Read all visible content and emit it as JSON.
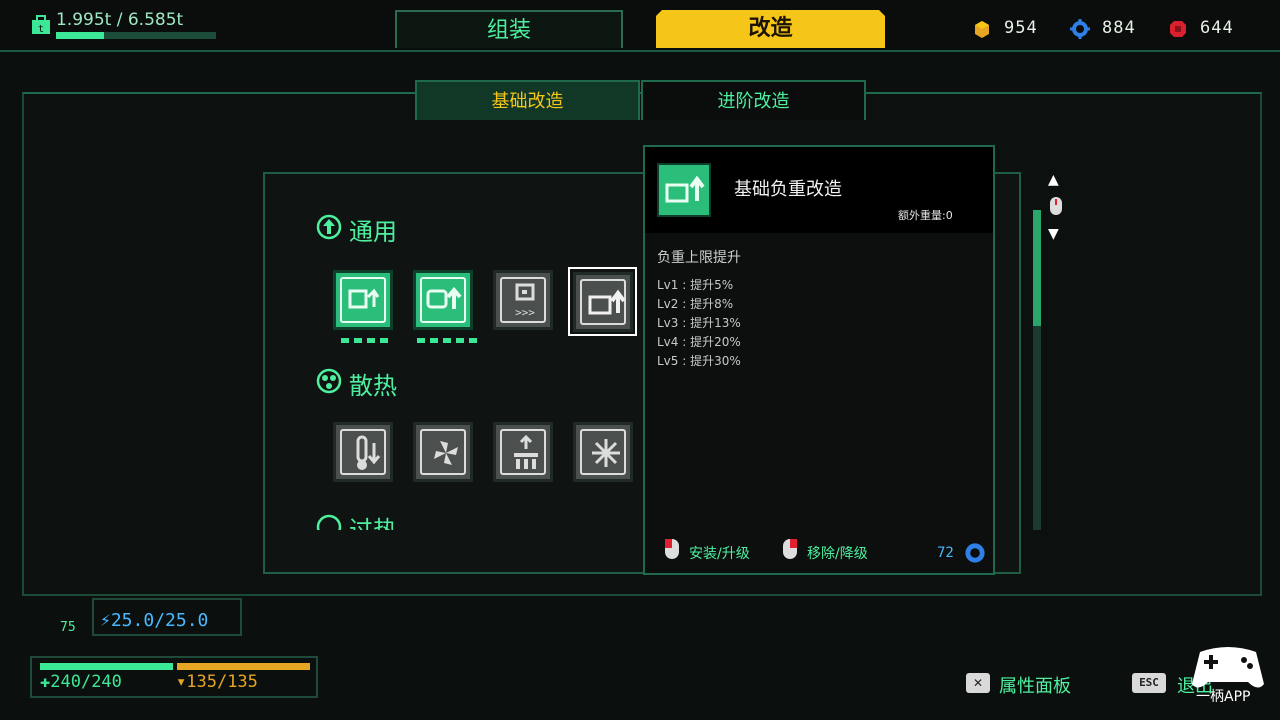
{
  "colors": {
    "accent_green": "#4ef0a0",
    "accent_yellow": "#f5c518",
    "bg": "#0b0f0d",
    "blue": "#4ab8ff",
    "orange": "#e6a623"
  },
  "weight": {
    "text": "1.995t / 6.585t",
    "fill_fraction": 0.303,
    "icon": "weight-icon"
  },
  "tabs": {
    "assemble": "组装",
    "modify": "改造"
  },
  "resources": [
    {
      "icon": "gold-block-icon",
      "value": "954"
    },
    {
      "icon": "blue-gear-icon",
      "value": "884"
    },
    {
      "icon": "red-chip-icon",
      "value": "644"
    }
  ],
  "subtabs": {
    "basic": "基础改造",
    "advanced": "进阶改造"
  },
  "sections": {
    "general": "通用",
    "cooling": "散热",
    "overheat": "过热"
  },
  "tooltip": {
    "title": "基础负重改造",
    "extra_weight": "额外重量:0",
    "description": "负重上限提升",
    "levels": [
      "Lv1 : 提升5%",
      "Lv2 : 提升8%",
      "Lv3 : 提升13%",
      "Lv4 : 提升20%",
      "Lv5 : 提升30%"
    ],
    "install_label": "安装/升级",
    "remove_label": "移除/降级",
    "cost": "72"
  },
  "stats": {
    "battery": "25.0/25.0",
    "level": "75",
    "hp": "240/240",
    "heat": "135/135"
  },
  "footer": {
    "attr_key": "✕",
    "attr_label": "属性面板",
    "esc_key": "ESC",
    "exit_label": "退出"
  },
  "watermark": {
    "text": "一柄APP"
  }
}
